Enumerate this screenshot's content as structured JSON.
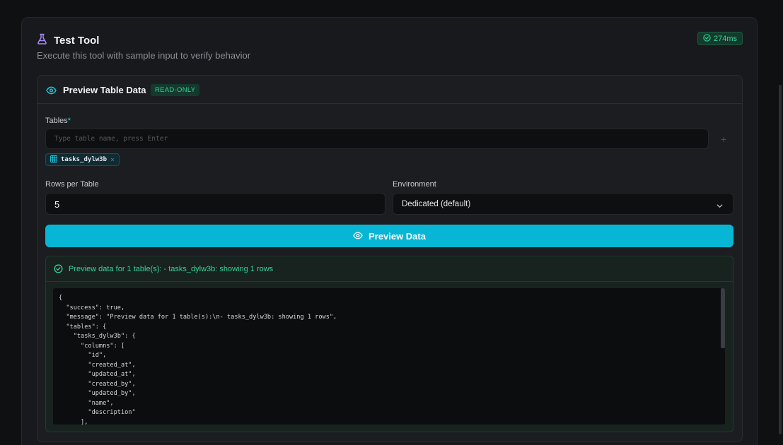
{
  "header": {
    "title": "Test Tool",
    "subtitle": "Execute this tool with sample input to verify behavior",
    "timing": "274ms"
  },
  "tool": {
    "name": "Preview Table Data",
    "badge": "READ-ONLY"
  },
  "form": {
    "tables_label": "Tables",
    "tables_required_mark": "*",
    "tables_placeholder": "Type table name, press Enter",
    "add_symbol": "+",
    "table_chips": [
      "tasks_dylw3b"
    ],
    "rows_label": "Rows per Table",
    "rows_value": "5",
    "environment_label": "Environment",
    "environment_value": "Dedicated (default)"
  },
  "actions": {
    "preview_label": "Preview Data"
  },
  "result": {
    "status_message": "Preview data for 1 table(s): - tasks_dylw3b: showing 1 rows",
    "json_text": "{\n  \"success\": true,\n  \"message\": \"Preview data for 1 table(s):\\n- tasks_dylw3b: showing 1 rows\",\n  \"tables\": {\n    \"tasks_dylw3b\": {\n      \"columns\": [\n        \"id\",\n        \"created_at\",\n        \"updated_at\",\n        \"created_by\",\n        \"updated_by\",\n        \"name\",\n        \"description\"\n      ],"
  },
  "colors": {
    "accent": "#06b6d4",
    "success": "#34d399",
    "flask_icon": "#a78bfa"
  }
}
